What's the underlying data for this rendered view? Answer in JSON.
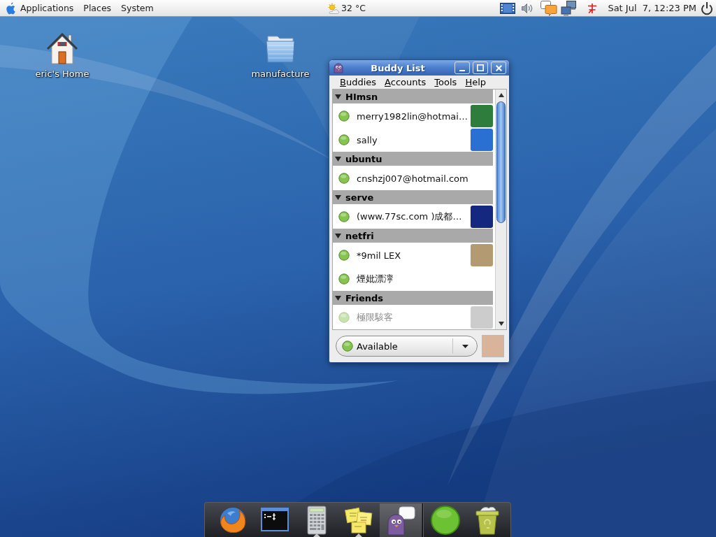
{
  "top_panel": {
    "menus": [
      {
        "label": "Applications"
      },
      {
        "label": "Places"
      },
      {
        "label": "System"
      }
    ],
    "weather": {
      "temperature": "32 °C"
    },
    "clock": "Sat Jul  7, 12:23 PM"
  },
  "desktop_icons": [
    {
      "kind": "home",
      "label": "eric's Home"
    },
    {
      "kind": "folder",
      "label": "manufacture"
    }
  ],
  "buddy_list": {
    "title": "Buddy List",
    "menus": [
      "Buddies",
      "Accounts",
      "Tools",
      "Help"
    ],
    "groups": [
      {
        "name": "HImsn",
        "expanded": true,
        "buddies": [
          {
            "name": "merry1982lin@hotmai…",
            "avatar": true,
            "idle": false
          },
          {
            "name": "sally",
            "avatar": true,
            "idle": false
          }
        ]
      },
      {
        "name": "ubuntu",
        "expanded": true,
        "buddies": [
          {
            "name": "cnshzj007@hotmail.com",
            "avatar": false,
            "idle": false
          }
        ]
      },
      {
        "name": "serve",
        "expanded": true,
        "buddies": [
          {
            "name": "(www.77sc.com )成都…",
            "avatar": true,
            "idle": false
          }
        ]
      },
      {
        "name": "netfri",
        "expanded": true,
        "buddies": [
          {
            "name": "*9mil LEX",
            "avatar": true,
            "idle": false
          },
          {
            "name": "煙妣漂濘",
            "avatar": false,
            "idle": false
          }
        ]
      },
      {
        "name": "Friends",
        "expanded": true,
        "buddies": [
          {
            "name": "極限駭客",
            "avatar": true,
            "idle": true
          }
        ]
      }
    ],
    "status": {
      "label": "Available"
    }
  },
  "dock": {
    "launchers": [
      {
        "kind": "browser",
        "running": false,
        "active": false
      },
      {
        "kind": "terminal",
        "running": false,
        "active": false
      },
      {
        "kind": "calculator",
        "running": true,
        "active": false
      },
      {
        "kind": "notes",
        "running": true,
        "active": false
      },
      {
        "kind": "messenger",
        "running": false,
        "active": true
      }
    ],
    "applets": [
      {
        "kind": "status",
        "running": false,
        "active": false
      },
      {
        "kind": "trash",
        "running": false,
        "active": false
      }
    ]
  }
}
